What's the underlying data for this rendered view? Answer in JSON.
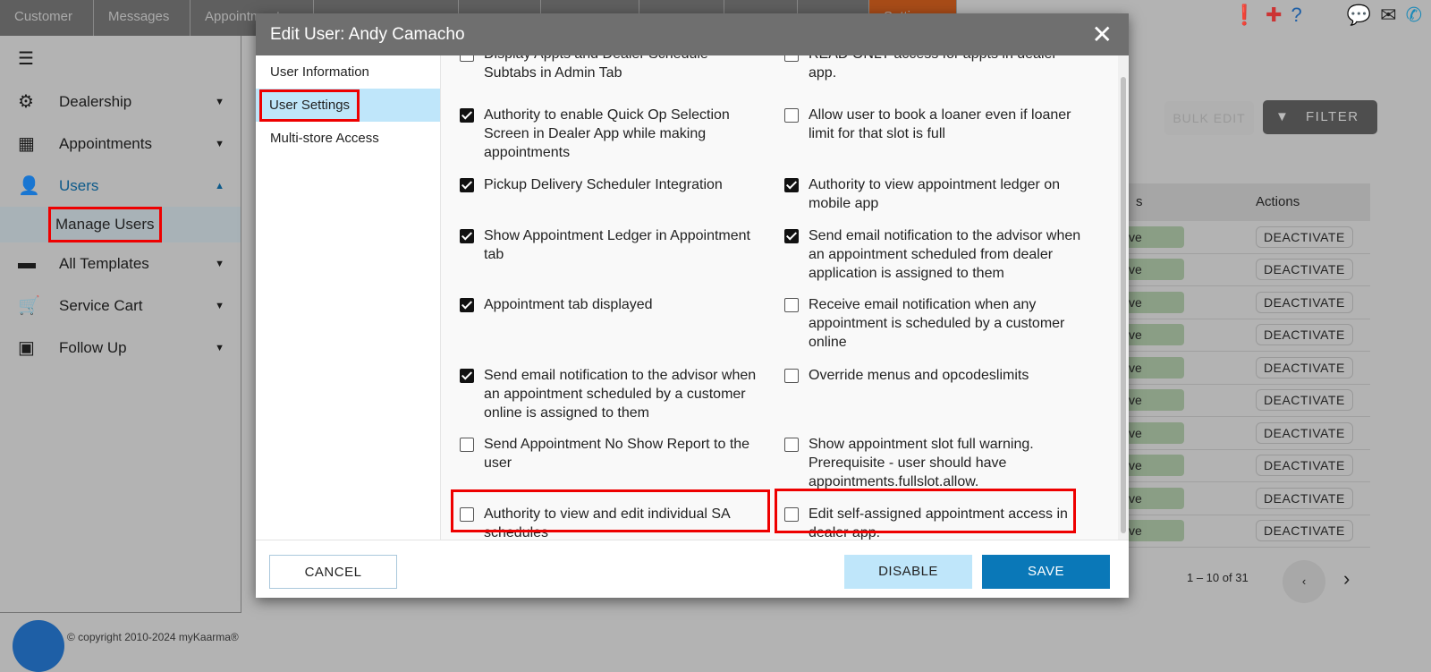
{
  "top_tabs": [
    "Customer",
    "Messages",
    "Appointments",
    "",
    "",
    "",
    "",
    "",
    "",
    "Settings"
  ],
  "sidebar": {
    "items": [
      {
        "icon": "gear-icon",
        "label": "Dealership"
      },
      {
        "icon": "calendar-icon",
        "label": "Appointments"
      },
      {
        "icon": "person-icon",
        "label": "Users"
      },
      {
        "icon": "chat-icon",
        "label": "All Templates"
      },
      {
        "icon": "cart-icon",
        "label": "Service Cart"
      },
      {
        "icon": "clipboard-icon",
        "label": "Follow Up"
      }
    ],
    "sub_item": "Manage Users"
  },
  "main": {
    "bulk_edit": "BULK EDIT",
    "filter": "FILTER",
    "table_headers": [
      "s",
      "Actions"
    ],
    "row_status": "ve",
    "row_action": "DEACTIVATE",
    "pager": "1 – 10 of 31"
  },
  "footer": "© copyright 2010-2024 myKaarma®",
  "modal": {
    "title": "Edit User: Andy Camacho",
    "nav": [
      "User Information",
      "User Settings",
      "Multi-store Access"
    ],
    "options": [
      {
        "label": "Display Appts and Dealer Schedule Subtabs in Admin Tab",
        "checked": false
      },
      {
        "label": "READ ONLY access for appts in dealer app.",
        "checked": false
      },
      {
        "label": "Authority to enable Quick Op Selection Screen in Dealer App while making appointments",
        "checked": true
      },
      {
        "label": "Allow user to book a loaner even if loaner limit for that slot is full",
        "checked": false
      },
      {
        "label": "Pickup Delivery Scheduler Integration",
        "checked": true
      },
      {
        "label": "Authority to view appointment ledger on mobile app",
        "checked": true
      },
      {
        "label": "Show Appointment Ledger in Appointment tab",
        "checked": true
      },
      {
        "label": "Send email notification to the advisor when an appointment scheduled from dealer application is assigned to them",
        "checked": true
      },
      {
        "label": "Appointment tab displayed",
        "checked": true
      },
      {
        "label": "Receive email notification when any appointment is scheduled by a customer online",
        "checked": false
      },
      {
        "label": "Send email notification to the advisor when an appointment scheduled by a customer online is assigned to them",
        "checked": true
      },
      {
        "label": "Override menus and opcodeslimits",
        "checked": false
      },
      {
        "label": "Send Appointment No Show Report to the user",
        "checked": false
      },
      {
        "label": "Show appointment slot full warning. Prerequisite - user should have appointments.fullslot.allow.",
        "checked": false
      },
      {
        "label": "Authority to view and edit individual SA schedules",
        "checked": false
      },
      {
        "label": "Edit self-assigned appointment access in dealer app.",
        "checked": false
      }
    ],
    "cancel": "CANCEL",
    "disable": "DISABLE",
    "save": "SAVE"
  },
  "colors": {
    "accent": "#0a78b8",
    "highlight": "#e00000",
    "selected_nav": "#bfe6fa",
    "settings_tab": "#a84c18"
  }
}
